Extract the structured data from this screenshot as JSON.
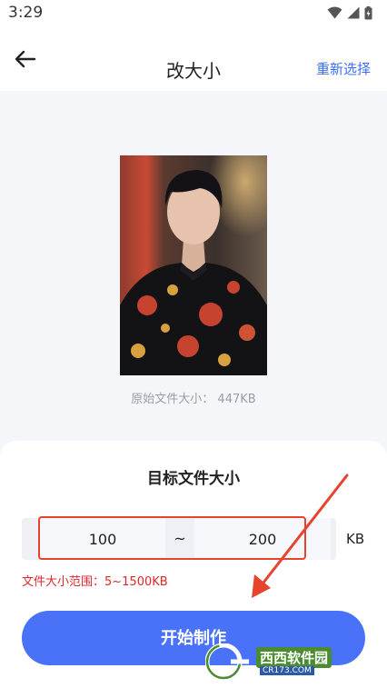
{
  "status_bar": {
    "time": "3:29"
  },
  "header": {
    "title": "改大小",
    "reselect_label": "重新选择"
  },
  "preview": {
    "original_size_text": "原始文件大小： 447KB"
  },
  "sheet": {
    "title": "目标文件大小",
    "min_value": "100",
    "separator": "~",
    "max_value": "200",
    "unit": "KB",
    "range_hint": "文件大小范围：5~1500KB",
    "start_button_label": "开始制作"
  },
  "watermark": {
    "brand": "西西软件园",
    "url": "CR173.COM"
  },
  "colors": {
    "accent": "#4a72f9",
    "link": "#3c6ef5",
    "error": "#e0272a",
    "annotation": "#e8432f"
  }
}
